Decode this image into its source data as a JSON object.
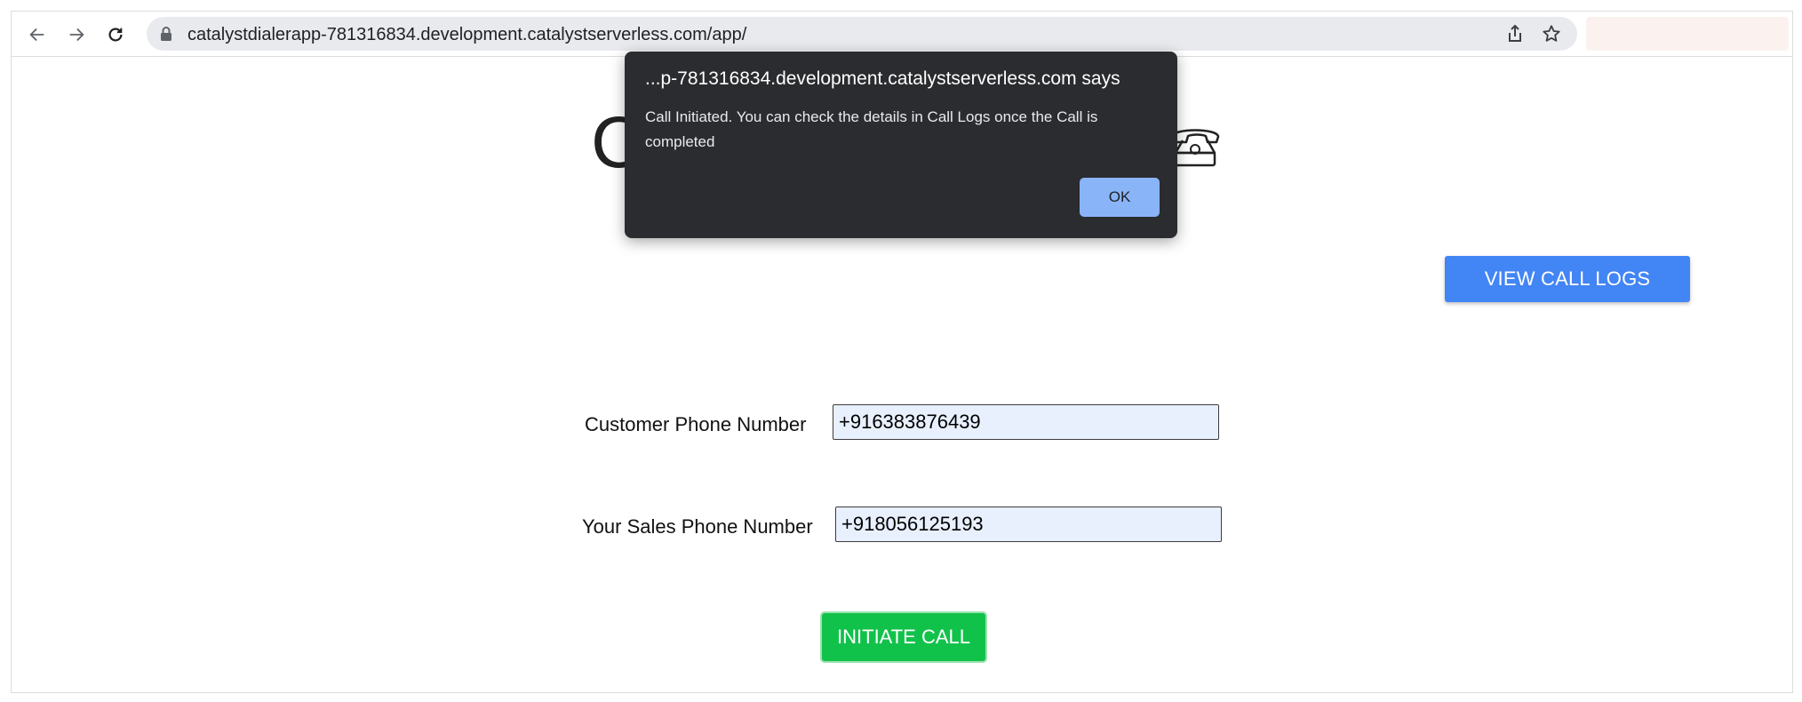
{
  "browser": {
    "url": "catalystdialerapp-781316834.development.catalystserverless.com/app/",
    "icons": [
      "back-arrow-icon",
      "forward-arrow-icon",
      "reload-icon",
      "lock-icon",
      "share-icon",
      "bookmark-star-icon"
    ]
  },
  "app": {
    "title_fragment_left": "C",
    "title_icon": "telephone-icon",
    "view_call_logs_label": "VIEW CALL LOGS",
    "customer_phone_label": "Customer Phone Number",
    "customer_phone_value": "+916383876439",
    "sales_phone_label": "Your Sales Phone Number",
    "sales_phone_value": "+918056125193",
    "initiate_call_label": "INITIATE CALL"
  },
  "dialog": {
    "title": "...p-781316834.development.catalystserverless.com says",
    "message": "Call Initiated. You can check the details in Call Logs once the Call is completed",
    "ok_label": "OK"
  },
  "colors": {
    "primary_button": "#4285f4",
    "initiate_button": "#11c24a",
    "dialog_bg": "#2b2c2f",
    "dialog_ok": "#8ab4f8",
    "input_bg": "#e8f0fe"
  }
}
